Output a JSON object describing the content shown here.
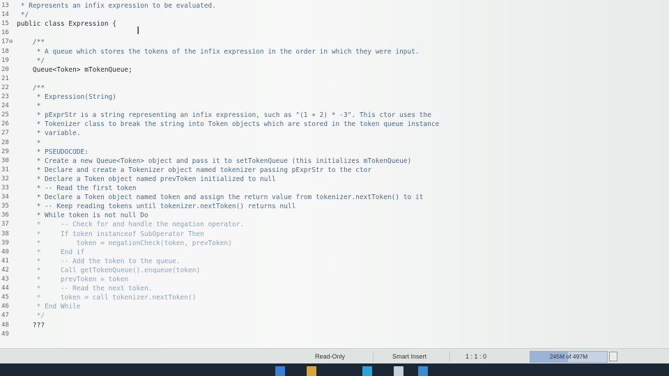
{
  "editor": {
    "lines": [
      {
        "num": "13",
        "text": " * Represents an infix expression to be evaluated.",
        "style": "comment"
      },
      {
        "num": "14",
        "text": " */",
        "style": "comment"
      },
      {
        "num": "15",
        "text": "public class Expression {",
        "style": "code"
      },
      {
        "num": "16",
        "text": "",
        "style": "code"
      },
      {
        "num": "17⊖",
        "text": "    /**",
        "style": "comment"
      },
      {
        "num": "18",
        "text": "     * A queue which stores the tokens of the infix expression in the order in which they were input.",
        "style": "comment"
      },
      {
        "num": "19",
        "text": "     */",
        "style": "comment"
      },
      {
        "num": "20",
        "text": "    Queue<Token> mTokenQueue;",
        "style": "code"
      },
      {
        "num": "21",
        "text": "",
        "style": "code"
      },
      {
        "num": "22",
        "text": "    /**",
        "style": "comment"
      },
      {
        "num": "23",
        "text": "     * Expression(String)",
        "style": "comment"
      },
      {
        "num": "24",
        "text": "     *",
        "style": "comment"
      },
      {
        "num": "25",
        "text": "     * pExprStr is a string representing an infix expression, such as \"(1 + 2) * -3\". This ctor uses the",
        "style": "comment"
      },
      {
        "num": "26",
        "text": "     * Tokenizer class to break the string into Token objects which are stored in the token queue instance",
        "style": "comment"
      },
      {
        "num": "27",
        "text": "     * variable.",
        "style": "comment"
      },
      {
        "num": "28",
        "text": "     *",
        "style": "comment"
      },
      {
        "num": "29",
        "text": "     * PSEUDOCODE:",
        "style": "comment"
      },
      {
        "num": "30",
        "text": "     * Create a new Queue<Token> object and pass it to setTokenQueue (this initializes mTokenQueue)",
        "style": "comment"
      },
      {
        "num": "31",
        "text": "     * Declare and create a Tokenizer object named tokenizer passing pExprStr to the ctor",
        "style": "comment"
      },
      {
        "num": "32",
        "text": "     * Declare a Token object named prevToken initialized to null",
        "style": "comment"
      },
      {
        "num": "33",
        "text": "     * -- Read the first token",
        "style": "comment"
      },
      {
        "num": "34",
        "text": "     * Declare a Token object named token and assign the return value from tokenizer.nextToken() to it",
        "style": "comment"
      },
      {
        "num": "35",
        "text": "     * -- Keep reading tokens until tokenizer.nextToken() returns null",
        "style": "comment"
      },
      {
        "num": "36",
        "text": "     * While token is not null Do",
        "style": "comment"
      },
      {
        "num": "37",
        "text": "     *     -- Check for and handle the negation operator.",
        "style": "faded"
      },
      {
        "num": "38",
        "text": "     *     If token instanceof SubOperator Then",
        "style": "faded"
      },
      {
        "num": "39",
        "text": "     *         token = negationCheck(token, prevToken)",
        "style": "faded"
      },
      {
        "num": "40",
        "text": "     *     End if",
        "style": "faded"
      },
      {
        "num": "41",
        "text": "     *     -- Add the token to the queue.",
        "style": "faded"
      },
      {
        "num": "42",
        "text": "     *     Call getTokenQueue().enqueue(token)",
        "style": "faded"
      },
      {
        "num": "43",
        "text": "     *     prevToken = token",
        "style": "faded"
      },
      {
        "num": "44",
        "text": "     *     -- Read the next token.",
        "style": "faded"
      },
      {
        "num": "45",
        "text": "     *     token = call tokenizer.nextToken()",
        "style": "faded"
      },
      {
        "num": "46",
        "text": "     * End While",
        "style": "faded"
      },
      {
        "num": "47",
        "text": "     */",
        "style": "faded"
      },
      {
        "num": "48",
        "text": "    ???",
        "style": "code"
      },
      {
        "num": "49",
        "text": "",
        "style": "code"
      }
    ]
  },
  "status": {
    "readonly": "Read-Only",
    "insert_mode": "Smart Insert",
    "position": "1 : 1 : 0",
    "memory": "245M of 497M",
    "memory_fraction": 0.49
  },
  "taskbar": {
    "icon_colors": [
      "#3a7fd5",
      "#d9a23a",
      "#2fa3d8",
      "#c8d0d8",
      "#3a8bd1"
    ]
  }
}
